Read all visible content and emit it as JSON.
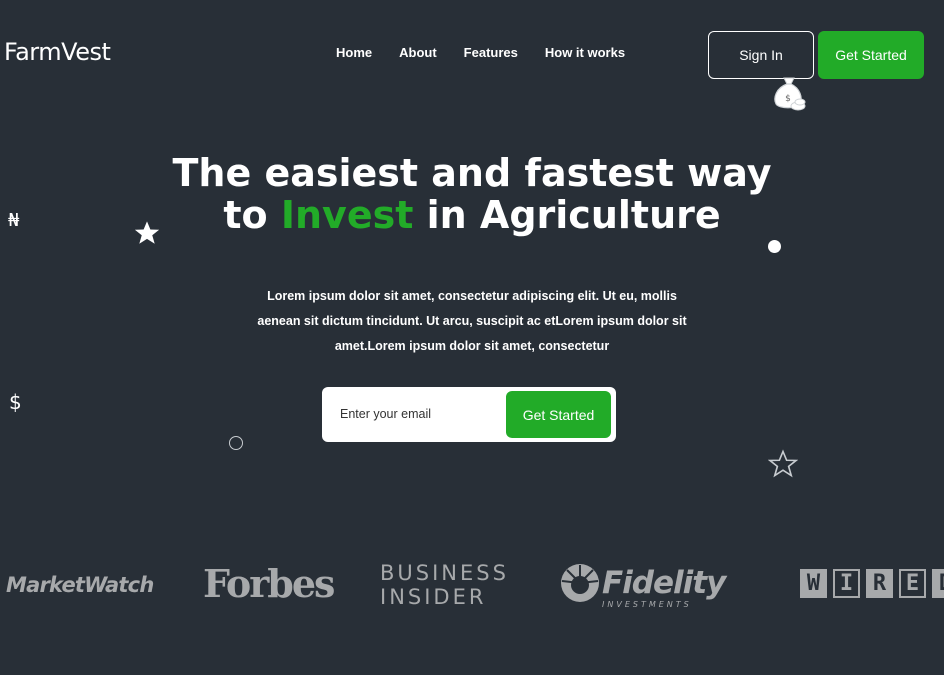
{
  "brand": {
    "name": "FarmVest"
  },
  "nav": {
    "items": [
      {
        "label": "Home"
      },
      {
        "label": "About"
      },
      {
        "label": "Features"
      },
      {
        "label": "How it works"
      }
    ]
  },
  "header": {
    "sign_in_label": "Sign In",
    "get_started_label": "Get Started"
  },
  "hero": {
    "title_line1": "The easiest and fastest way",
    "title_line2_prefix": "to ",
    "title_line2_accent": "Invest",
    "title_line2_suffix": " in Agriculture",
    "description": "Lorem ipsum dolor sit amet, consectetur adipiscing elit. Ut eu, mollis aenean sit dictum tincidunt. Ut arcu, suscipit ac etLorem ipsum dolor sit amet.Lorem ipsum dolor sit amet, consectetur"
  },
  "signup": {
    "email_placeholder": "Enter your email",
    "button_label": "Get Started"
  },
  "decorations": {
    "naira_symbol": "₦",
    "dollar_symbol": "$"
  },
  "press_logos": {
    "marketwatch": "MarketWatch",
    "forbes": "Forbes",
    "business_insider_line1": "BUSINESS",
    "business_insider_line2": "INSIDER",
    "fidelity": "Fidelity",
    "fidelity_sub": "INVESTMENTS",
    "wired_letters": [
      "W",
      "I",
      "R",
      "E",
      "D"
    ]
  },
  "colors": {
    "background": "#282f37",
    "accent": "#22ab28",
    "logo_gray": "#a7a9ab"
  }
}
